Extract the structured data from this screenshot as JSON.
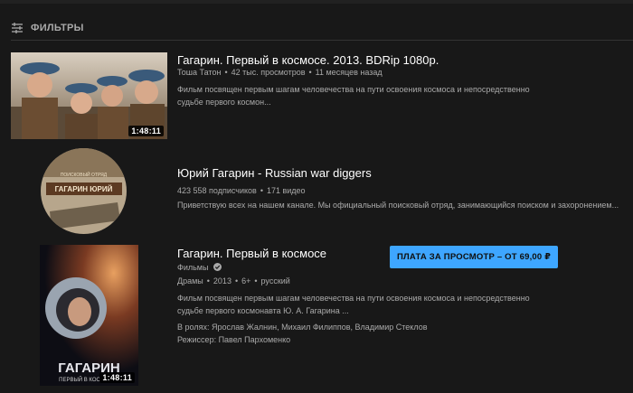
{
  "filters": {
    "label": "ФИЛЬТРЫ",
    "icon": "sliders-icon"
  },
  "results": [
    {
      "type": "video",
      "title": "Гагарин. Первый в космосе. 2013. BDRip 1080p.",
      "channel": "Тоша Татон",
      "views": "42 тыс. просмотров",
      "age": "11 месяцев назад",
      "description_lines": [
        "Фильм посвящен первым шагам человечества на пути освоения космоса и непосредственно",
        "судьбе первого космон..."
      ],
      "duration": "1:48:11"
    },
    {
      "type": "channel",
      "title": "Юрий Гагарин - Russian war diggers",
      "avatar_text_top": "ПОИСКОВЫЙ ОТРЯД",
      "avatar_text_main": "ГАГАРИН ЮРИЙ",
      "subscribers": "423 558 подписчиков",
      "videos": "171 видео",
      "description": "Приветствую всех на нашем канале. Мы официальный поисковый отряд, занимающийся поиском и захоронением..."
    },
    {
      "type": "movie",
      "title": "Гагарин. Первый в космосе",
      "channel": "Фильмы",
      "genre": "Драмы",
      "year": "2013",
      "rating": "6+",
      "language": "русский",
      "description_lines": [
        "Фильм посвящен первым шагам человечества на пути освоения космоса и непосредственно",
        "судьбе первого космонавта Ю. А. Гагарина ..."
      ],
      "cast": "В ролях: Ярослав Жалнин, Михаил Филиппов, Владимир Стеклов",
      "director": "Режиссер: Павел Пархоменко",
      "poster_title": "ГАГАРИН",
      "poster_subtitle": "ПЕРВЫЙ В КОС",
      "duration": "1:48:11",
      "pay_button": "ПЛАТА ЗА ПРОСМОТР – ОТ 69,00 ₽"
    }
  ],
  "colors": {
    "background": "#181818",
    "accent": "#3ea6ff",
    "secondary_text": "#aaaaaa"
  }
}
